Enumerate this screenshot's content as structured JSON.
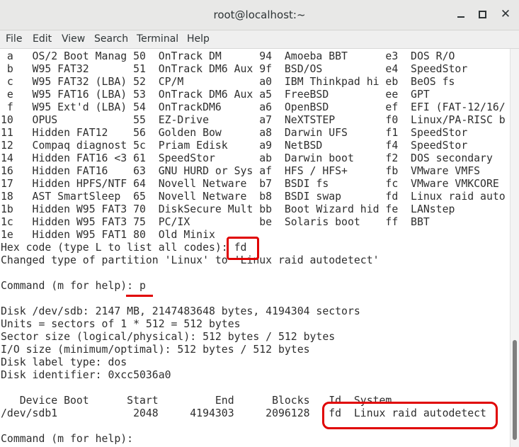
{
  "window": {
    "title": "root@localhost:~",
    "close_glyph": "✕"
  },
  "menu": [
    "File",
    "Edit",
    "View",
    "Search",
    "Terminal",
    "Help"
  ],
  "terminal": {
    "lines": [
      " a   OS/2 Boot Manag 50  OnTrack DM      94  Amoeba BBT      e3  DOS R/O",
      " b   W95 FAT32       51  OnTrack DM6 Aux 9f  BSD/OS          e4  SpeedStor",
      " c   W95 FAT32 (LBA) 52  CP/M            a0  IBM Thinkpad hi eb  BeOS fs",
      " e   W95 FAT16 (LBA) 53  OnTrack DM6 Aux a5  FreeBSD         ee  GPT",
      " f   W95 Ext'd (LBA) 54  OnTrackDM6      a6  OpenBSD         ef  EFI (FAT-12/16/",
      "10   OPUS            55  EZ-Drive        a7  NeXTSTEP        f0  Linux/PA-RISC b",
      "11   Hidden FAT12    56  Golden Bow      a8  Darwin UFS      f1  SpeedStor",
      "12   Compaq diagnost 5c  Priam Edisk     a9  NetBSD          f4  SpeedStor",
      "14   Hidden FAT16 <3 61  SpeedStor       ab  Darwin boot     f2  DOS secondary",
      "16   Hidden FAT16    63  GNU HURD or Sys af  HFS / HFS+      fb  VMware VMFS",
      "17   Hidden HPFS/NTF 64  Novell Netware  b7  BSDI fs         fc  VMware VMKCORE",
      "18   AST SmartSleep  65  Novell Netware  b8  BSDI swap       fd  Linux raid auto",
      "1b   Hidden W95 FAT3 70  DiskSecure Mult bb  Boot Wizard hid fe  LANstep",
      "1c   Hidden W95 FAT3 75  PC/IX           be  Solaris boot    ff  BBT",
      "1e   Hidden W95 FAT1 80  Old Minix",
      "Hex code (type L to list all codes): fd",
      "Changed type of partition 'Linux' to 'Linux raid autodetect'",
      "",
      "Command (m for help): p",
      "",
      "Disk /dev/sdb: 2147 MB, 2147483648 bytes, 4194304 sectors",
      "Units = sectors of 1 * 512 = 512 bytes",
      "Sector size (logical/physical): 512 bytes / 512 bytes",
      "I/O size (minimum/optimal): 512 bytes / 512 bytes",
      "Disk label type: dos",
      "Disk identifier: 0xcc5036a0",
      "",
      "   Device Boot      Start         End      Blocks   Id  System",
      "/dev/sdb1            2048     4194303     2096128   fd  Linux raid autodetect",
      "",
      "Command (m for help): "
    ]
  }
}
